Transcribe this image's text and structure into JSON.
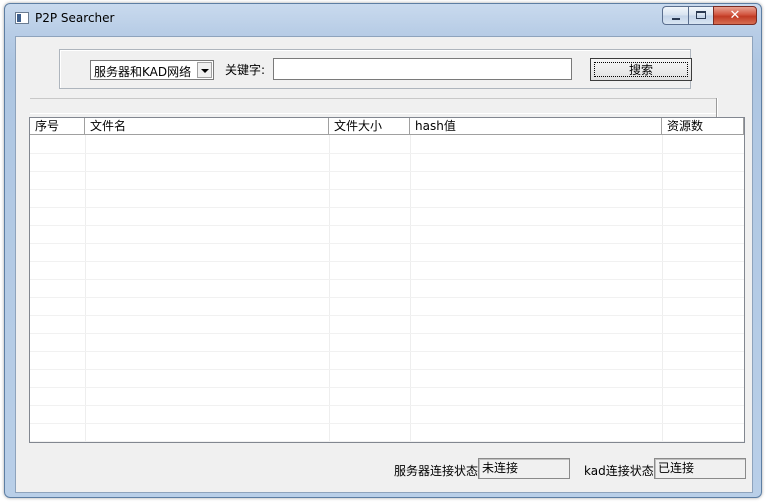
{
  "window": {
    "title": "P2P Searcher",
    "close_glyph": "✕",
    "icons": {
      "app": "app-icon",
      "minimize": "minimize-icon",
      "maximize": "maximize-icon",
      "close": "close-icon"
    }
  },
  "search": {
    "network_selected": "服务器和KAD网络",
    "keyword_label": "关键字:",
    "keyword_value": "",
    "keyword_placeholder": "",
    "search_button": "搜索"
  },
  "results": {
    "columns": [
      "序号",
      "文件名",
      "文件大小",
      "hash值",
      "资源数"
    ],
    "rows": []
  },
  "status": {
    "server_label": "服务器连接状态:",
    "server_value": "未连接",
    "kad_label": "kad连接状态:",
    "kad_value": "已连接"
  }
}
